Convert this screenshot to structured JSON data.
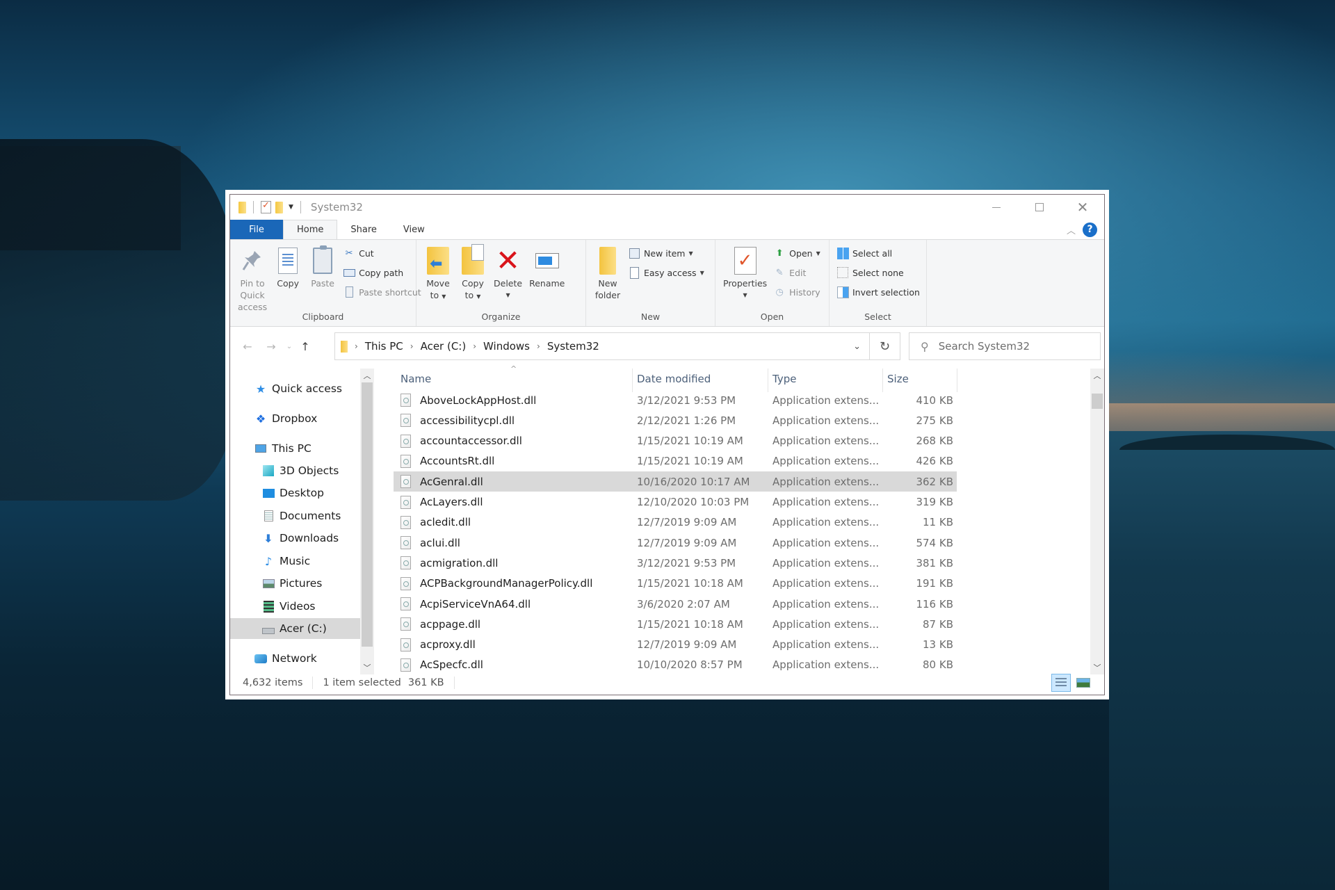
{
  "window": {
    "title": "System32",
    "controls": {
      "minimize": "minimize",
      "maximize": "maximize",
      "close": "close"
    }
  },
  "quick_access_toolbar": {
    "icons": [
      "folder-icon",
      "properties-icon",
      "new-folder-icon",
      "customize-dropdown-icon"
    ]
  },
  "ribbon_tabs": [
    {
      "label": "File",
      "active": false
    },
    {
      "label": "Home",
      "active": true
    },
    {
      "label": "Share",
      "active": false
    },
    {
      "label": "View",
      "active": false
    }
  ],
  "ribbon": {
    "clipboard": {
      "label": "Clipboard",
      "pin_line1": "Pin to Quick",
      "pin_line2": "access",
      "copy": "Copy",
      "paste": "Paste",
      "cut": "Cut",
      "copy_path": "Copy path",
      "paste_shortcut": "Paste shortcut"
    },
    "organize": {
      "label": "Organize",
      "move_line1": "Move",
      "move_line2": "to",
      "copy_line1": "Copy",
      "copy_line2": "to",
      "delete": "Delete",
      "rename": "Rename"
    },
    "new": {
      "label": "New",
      "new_folder_line1": "New",
      "new_folder_line2": "folder",
      "new_item": "New item",
      "easy_access": "Easy access"
    },
    "open": {
      "label": "Open",
      "properties": "Properties",
      "open": "Open",
      "edit": "Edit",
      "history": "History"
    },
    "select": {
      "label": "Select",
      "select_all": "Select all",
      "select_none": "Select none",
      "invert_selection": "Invert selection"
    }
  },
  "address": {
    "breadcrumbs": [
      "This PC",
      "Acer (C:)",
      "Windows",
      "System32"
    ],
    "search_placeholder": "Search System32"
  },
  "sidebar": {
    "items": [
      {
        "label": "Quick access",
        "icon": "star-icon",
        "level": 0
      },
      {
        "label": "Dropbox",
        "icon": "dropbox-icon",
        "level": 0
      },
      {
        "label": "This PC",
        "icon": "computer-icon",
        "level": 0
      },
      {
        "label": "3D Objects",
        "icon": "cube-icon",
        "level": 1
      },
      {
        "label": "Desktop",
        "icon": "desktop-icon",
        "level": 1
      },
      {
        "label": "Documents",
        "icon": "documents-icon",
        "level": 1
      },
      {
        "label": "Downloads",
        "icon": "download-icon",
        "level": 1
      },
      {
        "label": "Music",
        "icon": "music-icon",
        "level": 1
      },
      {
        "label": "Pictures",
        "icon": "pictures-icon",
        "level": 1
      },
      {
        "label": "Videos",
        "icon": "videos-icon",
        "level": 1
      },
      {
        "label": "Acer (C:)",
        "icon": "drive-icon",
        "level": 1,
        "selected": true
      },
      {
        "label": "Network",
        "icon": "network-icon",
        "level": 0
      }
    ]
  },
  "filelist": {
    "columns": {
      "name": "Name",
      "date": "Date modified",
      "type": "Type",
      "size": "Size"
    },
    "rows": [
      {
        "name": "AboveLockAppHost.dll",
        "date": "3/12/2021 9:53 PM",
        "type": "Application extens...",
        "size": "410 KB"
      },
      {
        "name": "accessibilitycpl.dll",
        "date": "2/12/2021 1:26 PM",
        "type": "Application extens...",
        "size": "275 KB"
      },
      {
        "name": "accountaccessor.dll",
        "date": "1/15/2021 10:19 AM",
        "type": "Application extens...",
        "size": "268 KB"
      },
      {
        "name": "AccountsRt.dll",
        "date": "1/15/2021 10:19 AM",
        "type": "Application extens...",
        "size": "426 KB"
      },
      {
        "name": "AcGenral.dll",
        "date": "10/16/2020 10:17 AM",
        "type": "Application extens...",
        "size": "362 KB",
        "selected": true
      },
      {
        "name": "AcLayers.dll",
        "date": "12/10/2020 10:03 PM",
        "type": "Application extens...",
        "size": "319 KB"
      },
      {
        "name": "acledit.dll",
        "date": "12/7/2019 9:09 AM",
        "type": "Application extens...",
        "size": "11 KB"
      },
      {
        "name": "aclui.dll",
        "date": "12/7/2019 9:09 AM",
        "type": "Application extens...",
        "size": "574 KB"
      },
      {
        "name": "acmigration.dll",
        "date": "3/12/2021 9:53 PM",
        "type": "Application extens...",
        "size": "381 KB"
      },
      {
        "name": "ACPBackgroundManagerPolicy.dll",
        "date": "1/15/2021 10:18 AM",
        "type": "Application extens...",
        "size": "191 KB"
      },
      {
        "name": "AcpiServiceVnA64.dll",
        "date": "3/6/2020 2:07 AM",
        "type": "Application extens...",
        "size": "116 KB"
      },
      {
        "name": "acppage.dll",
        "date": "1/15/2021 10:18 AM",
        "type": "Application extens...",
        "size": "87 KB"
      },
      {
        "name": "acproxy.dll",
        "date": "12/7/2019 9:09 AM",
        "type": "Application extens...",
        "size": "13 KB"
      },
      {
        "name": "AcSpecfc.dll",
        "date": "10/10/2020 8:57 PM",
        "type": "Application extens...",
        "size": "80 KB"
      }
    ]
  },
  "status": {
    "item_count": "4,632 items",
    "selection": "1 item selected",
    "selection_size": "361 KB"
  },
  "colors": {
    "file_tab": "#1a67b8",
    "selection": "#d9d9d9",
    "help": "#1a6fc9",
    "delete": "#d9141b"
  }
}
